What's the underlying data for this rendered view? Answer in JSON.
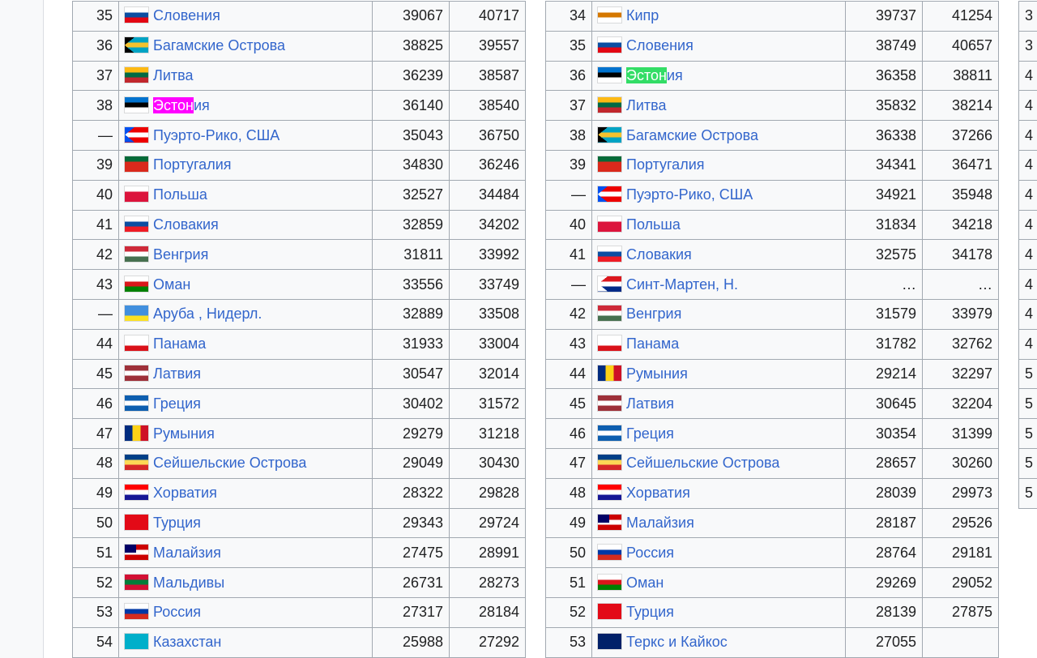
{
  "highlight_colors": {
    "magenta": "#ff00ff",
    "green": "#33dd66"
  },
  "left_table": [
    {
      "rank": "35",
      "name": "Словения",
      "v1": "39067",
      "v2": "40717",
      "flag": [
        "#ffffff",
        "#0b4ea2",
        "#e30613"
      ]
    },
    {
      "rank": "36",
      "name": "Багамские Острова",
      "v1": "38825",
      "v2": "39557",
      "flag": [
        "#00a3c4",
        "#f5c22e",
        "#00a3c4"
      ],
      "triangle": "#000000"
    },
    {
      "rank": "37",
      "name": "Литва",
      "v1": "36239",
      "v2": "38587",
      "flag": [
        "#fdb913",
        "#006a44",
        "#c1272d"
      ]
    },
    {
      "rank": "38",
      "name": "Эстония",
      "v1": "36140",
      "v2": "38540",
      "flag": [
        "#0072ce",
        "#000000",
        "#ffffff"
      ],
      "hl_part": "Эстон",
      "hl_rest": "ия",
      "hl_color": "#ff00ff"
    },
    {
      "rank": "—",
      "name": "Пуэрто-Рико, США",
      "v1": "35043",
      "v2": "36750",
      "flag": [
        "#ed0000",
        "#ffffff",
        "#ed0000"
      ],
      "triangle": "#0050f0"
    },
    {
      "rank": "39",
      "name": "Португалия",
      "v1": "34830",
      "v2": "36246",
      "flag": [
        "#046a38",
        "#da291c",
        "#da291c"
      ]
    },
    {
      "rank": "40",
      "name": "Польша",
      "v1": "32527",
      "v2": "34484",
      "flag": [
        "#ffffff",
        "#dc143c",
        "#dc143c"
      ]
    },
    {
      "rank": "41",
      "name": "Словакия",
      "v1": "32859",
      "v2": "34202",
      "flag": [
        "#ffffff",
        "#0b4ea2",
        "#ee1c25"
      ]
    },
    {
      "rank": "42",
      "name": "Венгрия",
      "v1": "31811",
      "v2": "33992",
      "flag": [
        "#ce2939",
        "#ffffff",
        "#477050"
      ]
    },
    {
      "rank": "43",
      "name": "Оман",
      "v1": "33556",
      "v2": "33749",
      "flag": [
        "#ffffff",
        "#db161b",
        "#008000"
      ]
    },
    {
      "rank": "—",
      "name": "Аруба , Нидерл.",
      "v1": "32889",
      "v2": "33508",
      "flag": [
        "#418fde",
        "#418fde",
        "#fbe122"
      ]
    },
    {
      "rank": "44",
      "name": "Панама",
      "v1": "31933",
      "v2": "33004",
      "flag": [
        "#ffffff",
        "#ffffff",
        "#da121a"
      ]
    },
    {
      "rank": "45",
      "name": "Латвия",
      "v1": "30547",
      "v2": "32014",
      "flag": [
        "#9e3039",
        "#ffffff",
        "#9e3039"
      ]
    },
    {
      "rank": "46",
      "name": "Греция",
      "v1": "30402",
      "v2": "31572",
      "flag": [
        "#0d5eaf",
        "#ffffff",
        "#0d5eaf"
      ]
    },
    {
      "rank": "47",
      "name": "Румыния",
      "v1": "29279",
      "v2": "31218",
      "flag": [
        "#002b7f",
        "#fcd116",
        "#ce1126"
      ],
      "vertical": true
    },
    {
      "rank": "48",
      "name": "Сейшельские Острова",
      "v1": "29049",
      "v2": "30430",
      "flag": [
        "#003f87",
        "#fcd856",
        "#d62828"
      ]
    },
    {
      "rank": "49",
      "name": "Хорватия",
      "v1": "28322",
      "v2": "29828",
      "flag": [
        "#ff0000",
        "#ffffff",
        "#171796"
      ]
    },
    {
      "rank": "50",
      "name": "Турция",
      "v1": "29343",
      "v2": "29724",
      "flag": [
        "#e30a17",
        "#e30a17",
        "#e30a17"
      ]
    },
    {
      "rank": "51",
      "name": "Малайзия",
      "v1": "27475",
      "v2": "28991",
      "flag": [
        "#cc0001",
        "#ffffff",
        "#cc0001"
      ],
      "canton": "#010066"
    },
    {
      "rank": "52",
      "name": "Мальдивы",
      "v1": "26731",
      "v2": "28273",
      "flag": [
        "#d21034",
        "#007e3a",
        "#d21034"
      ]
    },
    {
      "rank": "53",
      "name": "Россия",
      "v1": "27317",
      "v2": "28184",
      "flag": [
        "#ffffff",
        "#0039a6",
        "#d52b1e"
      ]
    },
    {
      "rank": "54",
      "name": "Казахстан",
      "v1": "25988",
      "v2": "27292",
      "flag": [
        "#00afca",
        "#00afca",
        "#00afca"
      ]
    }
  ],
  "right_table": [
    {
      "rank": "34",
      "name": "Кипр",
      "v1": "39737",
      "v2": "41254",
      "flag": [
        "#ffffff",
        "#d57800",
        "#ffffff"
      ]
    },
    {
      "rank": "35",
      "name": "Словения",
      "v1": "38749",
      "v2": "40657",
      "flag": [
        "#ffffff",
        "#0b4ea2",
        "#e30613"
      ]
    },
    {
      "rank": "36",
      "name": "Эстония",
      "v1": "36358",
      "v2": "38811",
      "flag": [
        "#0072ce",
        "#000000",
        "#ffffff"
      ],
      "hl_part": "Эстон",
      "hl_rest": "ия",
      "hl_color": "#33dd66"
    },
    {
      "rank": "37",
      "name": "Литва",
      "v1": "35832",
      "v2": "38214",
      "flag": [
        "#fdb913",
        "#006a44",
        "#c1272d"
      ]
    },
    {
      "rank": "38",
      "name": "Багамские Острова",
      "v1": "36338",
      "v2": "37266",
      "flag": [
        "#00a3c4",
        "#f5c22e",
        "#00a3c4"
      ],
      "triangle": "#000000"
    },
    {
      "rank": "39",
      "name": "Португалия",
      "v1": "34341",
      "v2": "36471",
      "flag": [
        "#046a38",
        "#da291c",
        "#da291c"
      ]
    },
    {
      "rank": "—",
      "name": "Пуэрто-Рико, США",
      "v1": "34921",
      "v2": "35948",
      "flag": [
        "#ed0000",
        "#ffffff",
        "#ed0000"
      ],
      "triangle": "#0050f0"
    },
    {
      "rank": "40",
      "name": "Польша",
      "v1": "31834",
      "v2": "34218",
      "flag": [
        "#ffffff",
        "#dc143c",
        "#dc143c"
      ]
    },
    {
      "rank": "41",
      "name": "Словакия",
      "v1": "32575",
      "v2": "34178",
      "flag": [
        "#ffffff",
        "#0b4ea2",
        "#ee1c25"
      ]
    },
    {
      "rank": "—",
      "name": "Синт-Мартен, Н.",
      "v1": "…",
      "v2": "…",
      "flag": [
        "#dc171d",
        "#ffffff",
        "#012a87"
      ],
      "triangle": "#ffffff"
    },
    {
      "rank": "42",
      "name": "Венгрия",
      "v1": "31579",
      "v2": "33979",
      "flag": [
        "#ce2939",
        "#ffffff",
        "#477050"
      ]
    },
    {
      "rank": "43",
      "name": "Панама",
      "v1": "31782",
      "v2": "32762",
      "flag": [
        "#ffffff",
        "#ffffff",
        "#da121a"
      ]
    },
    {
      "rank": "44",
      "name": "Румыния",
      "v1": "29214",
      "v2": "32297",
      "flag": [
        "#002b7f",
        "#fcd116",
        "#ce1126"
      ],
      "vertical": true
    },
    {
      "rank": "45",
      "name": "Латвия",
      "v1": "30645",
      "v2": "32204",
      "flag": [
        "#9e3039",
        "#ffffff",
        "#9e3039"
      ]
    },
    {
      "rank": "46",
      "name": "Греция",
      "v1": "30354",
      "v2": "31399",
      "flag": [
        "#0d5eaf",
        "#ffffff",
        "#0d5eaf"
      ]
    },
    {
      "rank": "47",
      "name": "Сейшельские Острова",
      "v1": "28657",
      "v2": "30260",
      "flag": [
        "#003f87",
        "#fcd856",
        "#d62828"
      ]
    },
    {
      "rank": "48",
      "name": "Хорватия",
      "v1": "28039",
      "v2": "29973",
      "flag": [
        "#ff0000",
        "#ffffff",
        "#171796"
      ]
    },
    {
      "rank": "49",
      "name": "Малайзия",
      "v1": "28187",
      "v2": "29526",
      "flag": [
        "#cc0001",
        "#ffffff",
        "#cc0001"
      ],
      "canton": "#010066"
    },
    {
      "rank": "50",
      "name": "Россия",
      "v1": "28764",
      "v2": "29181",
      "flag": [
        "#ffffff",
        "#0039a6",
        "#d52b1e"
      ]
    },
    {
      "rank": "51",
      "name": "Оман",
      "v1": "29269",
      "v2": "29052",
      "flag": [
        "#ffffff",
        "#db161b",
        "#008000"
      ]
    },
    {
      "rank": "52",
      "name": "Турция",
      "v1": "28139",
      "v2": "27875",
      "flag": [
        "#e30a17",
        "#e30a17",
        "#e30a17"
      ]
    },
    {
      "rank": "53",
      "name": "Теркс и Кайкос",
      "v1": "27055",
      "v2": "",
      "flag": [
        "#012169",
        "#012169",
        "#012169"
      ]
    }
  ],
  "third_table_ranks": [
    "3",
    "3",
    "4",
    "4",
    "4",
    "4",
    "4",
    "4",
    "4",
    "4",
    "4",
    "4",
    "5",
    "5",
    "5",
    "5",
    "5"
  ]
}
